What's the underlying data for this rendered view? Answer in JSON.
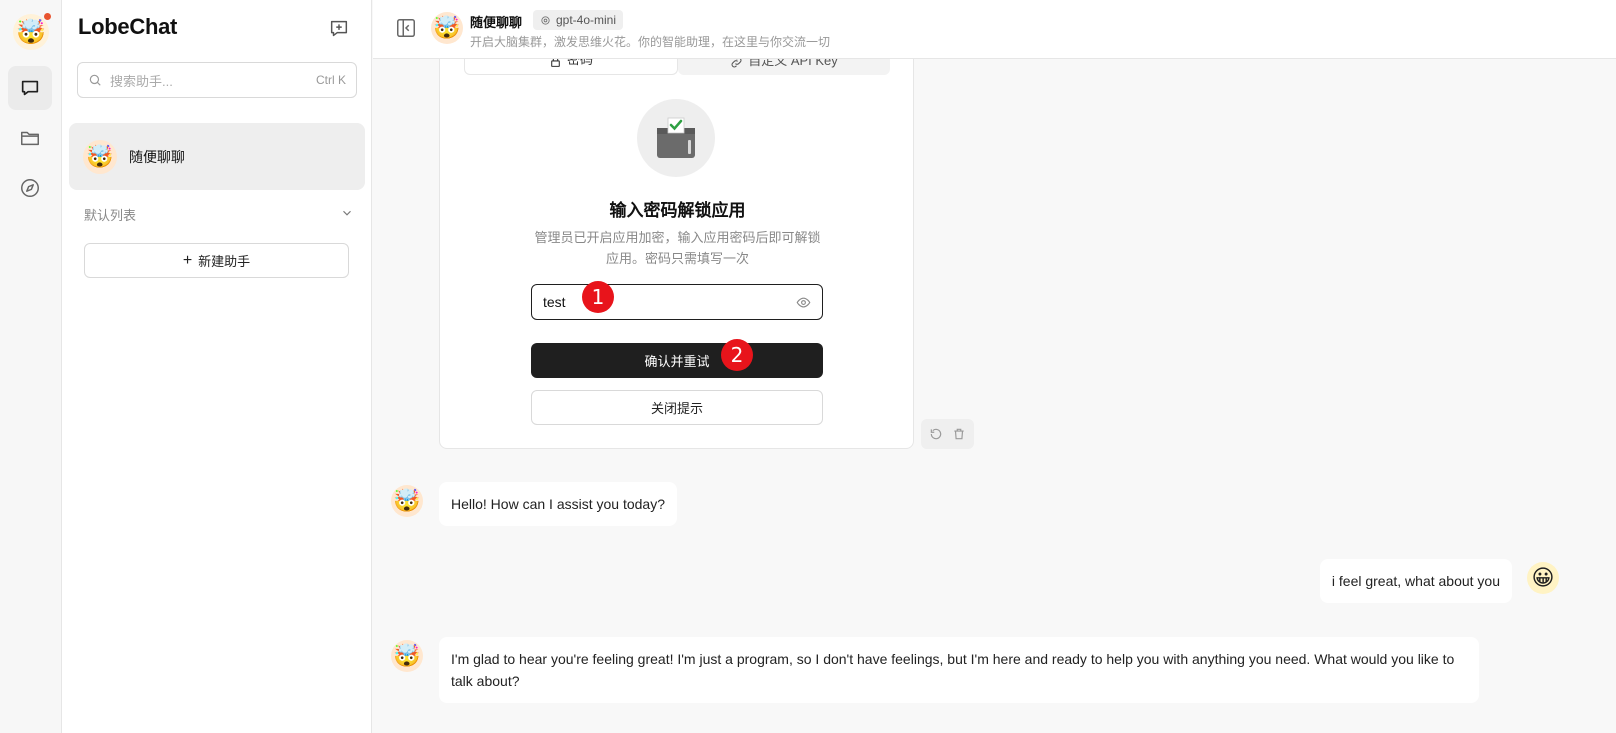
{
  "app": {
    "name": "LobeChat"
  },
  "sidebar": {
    "search_placeholder": "搜索助手...",
    "search_shortcut": "Ctrl K",
    "session": {
      "title": "随便聊聊"
    },
    "group_label": "默认列表",
    "new_agent_label": "新建助手"
  },
  "header": {
    "title": "随便聊聊",
    "model": "gpt-4o-mini",
    "description": "开启大脑集群，激发思维火花。你的智能助理，在这里与你交流一切"
  },
  "unlock": {
    "tabs": [
      {
        "label": "密码"
      },
      {
        "label": "自定义 API Key"
      }
    ],
    "title": "输入密码解锁应用",
    "description": "管理员已开启应用加密，输入应用密码后即可解锁应用。密码只需填写一次",
    "password_value": "test",
    "confirm_label": "确认并重试",
    "close_label": "关闭提示"
  },
  "markers": [
    "1",
    "2"
  ],
  "messages": [
    {
      "role": "assistant",
      "text": "Hello! How can I assist you today?"
    },
    {
      "role": "user",
      "text": "i feel great, what about you"
    },
    {
      "role": "assistant",
      "text": "I'm glad to hear you're feeling great! I'm just a program, so I don't have feelings, but I'm here and ready to help you with anything you need. What would you like to talk about?"
    }
  ],
  "avatars": {
    "assistant": "🤯",
    "user": "😀"
  },
  "colors": {
    "accent_dark": "#1f1f1f",
    "marker_red": "#e8141b",
    "notify_dot": "#e8542f"
  }
}
